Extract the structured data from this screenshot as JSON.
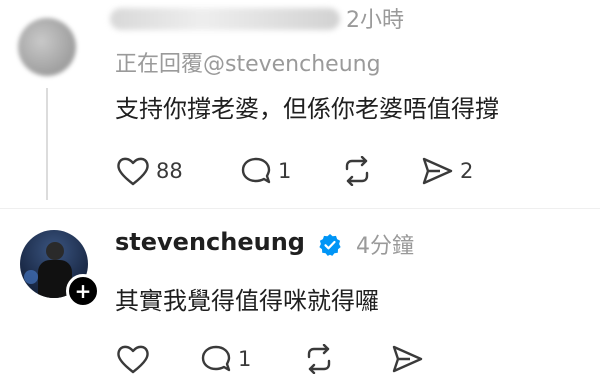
{
  "comment1": {
    "time": "2小時",
    "replying_to": "正在回覆@stevencheung",
    "text": "支持你撐老婆，但係你老婆唔值得撐",
    "actions": {
      "likes": "88",
      "comments": "1",
      "shares": "2"
    }
  },
  "comment2": {
    "username": "stevencheung",
    "time": "4分鐘",
    "text": "其實我覺得值得咪就得囉",
    "actions": {
      "comments": "1"
    }
  },
  "icons": {
    "like": "heart-icon",
    "comment": "comment-bubble-icon",
    "repost": "repost-icon",
    "share": "send-icon",
    "verified": "verified-badge-icon",
    "follow": "plus-icon"
  },
  "colors": {
    "verified_blue": "#0095f6",
    "muted_text": "#9a9a9a"
  }
}
